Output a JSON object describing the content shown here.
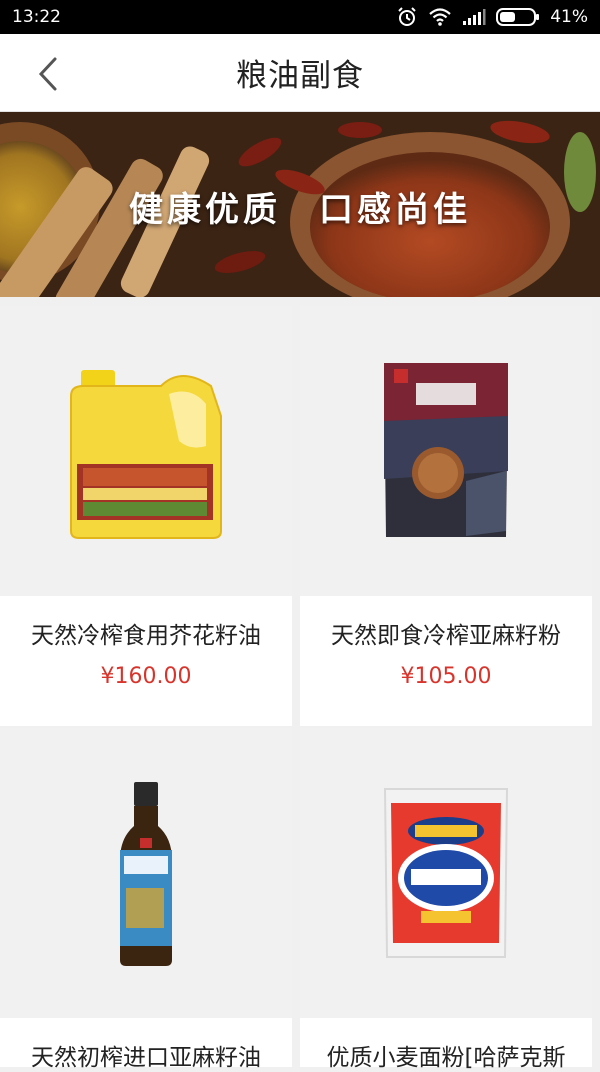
{
  "status": {
    "time": "13:22",
    "battery": "41%"
  },
  "header": {
    "title": "粮油副食"
  },
  "banner": {
    "text": "健康优质　口感尚佳"
  },
  "products": [
    {
      "name": "天然冷榨食用芥花籽油",
      "price": "¥160.00"
    },
    {
      "name": "天然即食冷榨亚麻籽粉",
      "price": "¥105.00"
    },
    {
      "name": "天然初榨进口亚麻籽油",
      "price": ""
    },
    {
      "name": "优质小麦面粉[哈萨克斯",
      "price": ""
    }
  ],
  "colors": {
    "price": "#d9342b",
    "background": "#f0f0f0"
  }
}
